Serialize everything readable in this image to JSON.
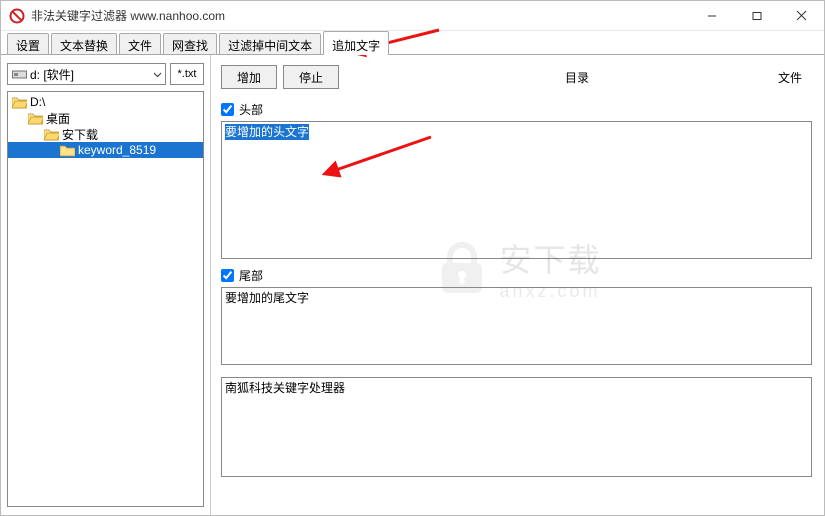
{
  "window": {
    "title": "非法关键字过滤器 www.nanhoo.com"
  },
  "tabs": [
    "设置",
    "文本替换",
    "文件",
    "网查找",
    "过滤掉中间文本",
    "追加文字"
  ],
  "active_tab_index": 5,
  "drive": {
    "selected": "d: [软件]",
    "ext_filter": "*.txt"
  },
  "tree": [
    {
      "label": "D:\\",
      "depth": 0,
      "open": true,
      "selected": false,
      "icon": "open"
    },
    {
      "label": "桌面",
      "depth": 1,
      "open": true,
      "selected": false,
      "icon": "open"
    },
    {
      "label": "安下载",
      "depth": 2,
      "open": true,
      "selected": false,
      "icon": "open"
    },
    {
      "label": "keyword_8519",
      "depth": 3,
      "open": false,
      "selected": true,
      "icon": "closed"
    }
  ],
  "buttons": {
    "add": "增加",
    "stop": "停止"
  },
  "column_headers": {
    "dir": "目录",
    "file": "文件"
  },
  "sections": {
    "head": {
      "label": "头部",
      "checked": true,
      "text": "要增加的头文字"
    },
    "tail": {
      "label": "尾部",
      "checked": true,
      "text": "要增加的尾文字"
    },
    "bottom": {
      "text": "南狐科技关键字处理器"
    }
  },
  "watermark": {
    "zh": "安下载",
    "sub": "anxz.com"
  }
}
